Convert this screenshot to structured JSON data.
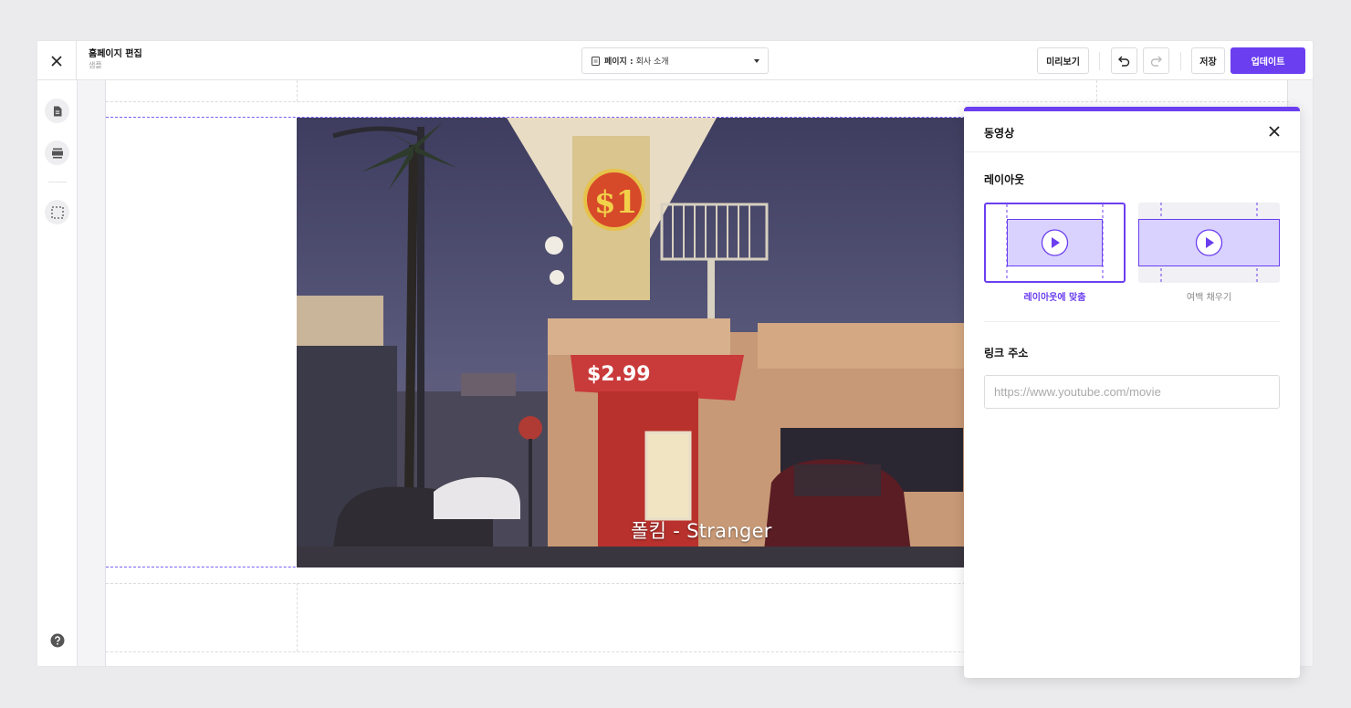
{
  "topbar": {
    "title": "홈페이지 편집",
    "subtitle": "샘플",
    "page_select_prefix": "페이지 :",
    "page_select_value": "회사 소개",
    "preview_label": "미리보기",
    "save_label": "저장",
    "update_label": "업데이트"
  },
  "rail": {
    "icons": [
      "page-icon",
      "section-icon",
      "select-area-icon",
      "help-icon"
    ]
  },
  "video": {
    "caption": "폴킴 - Stranger"
  },
  "panel": {
    "title": "동영상",
    "layout_section": "레이아웃",
    "layout_options": [
      {
        "label": "레이아웃에 맞춤",
        "selected": true
      },
      {
        "label": "여백 채우기",
        "selected": false
      }
    ],
    "link_section": "링크 주소",
    "link_placeholder": "https://www.youtube.com/movie",
    "link_value": ""
  },
  "colors": {
    "accent": "#6b3ef0",
    "option_bg": "#d9d2ff"
  }
}
